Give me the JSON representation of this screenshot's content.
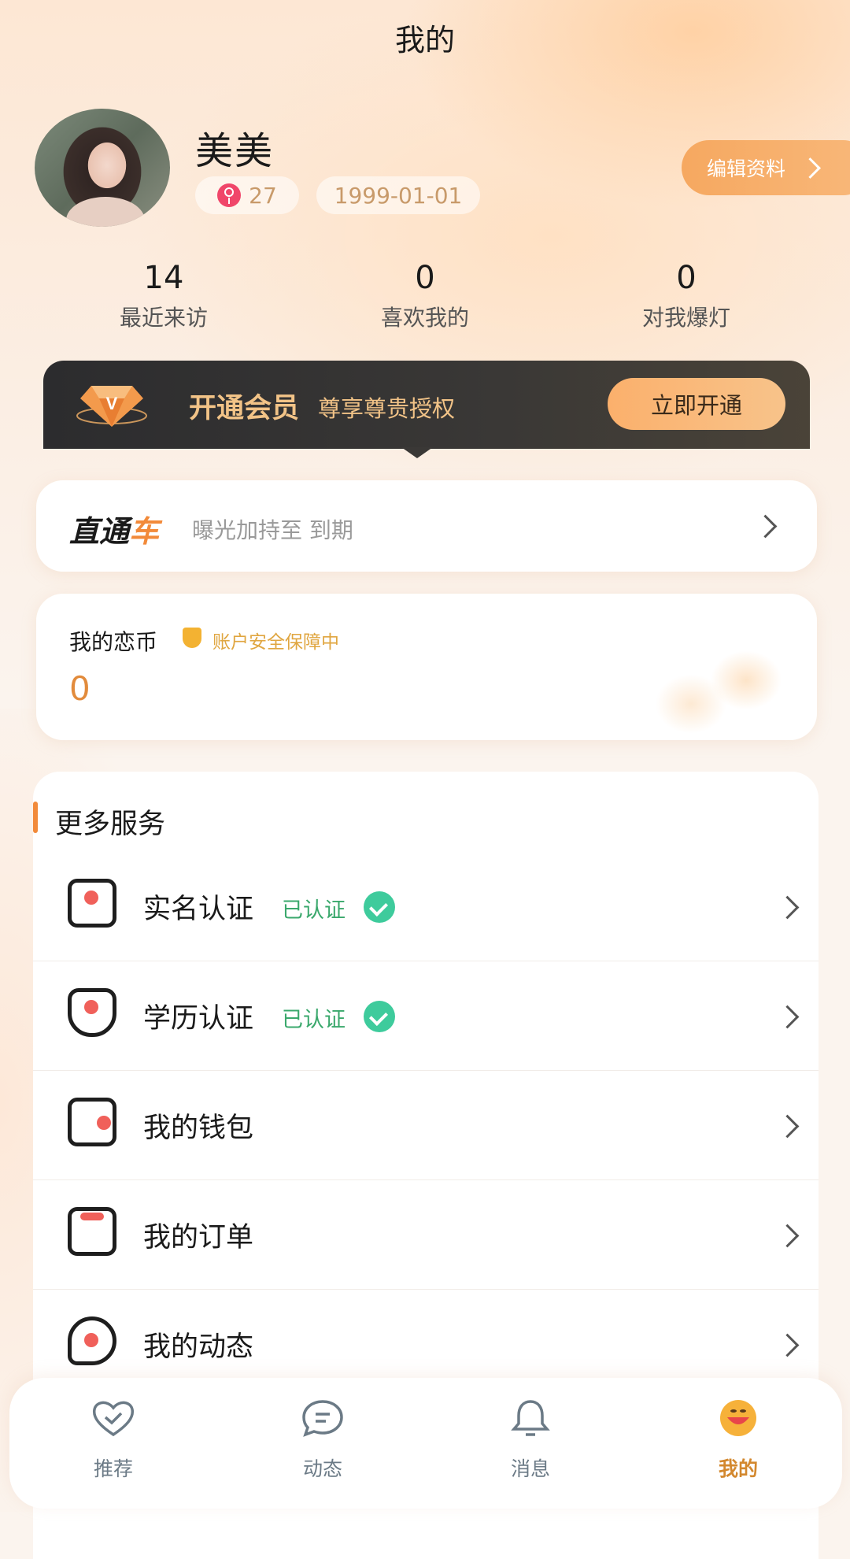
{
  "header": {
    "title": "我的"
  },
  "profile": {
    "name": "美美",
    "age": "27",
    "birthday": "1999-01-01",
    "edit_label": "编辑资料"
  },
  "stats": [
    {
      "value": "14",
      "label": "最近来访"
    },
    {
      "value": "0",
      "label": "喜欢我的"
    },
    {
      "value": "0",
      "label": "对我爆灯"
    }
  ],
  "vip": {
    "title": "开通会员",
    "subtitle": "尊享尊贵授权",
    "button": "立即开通"
  },
  "express": {
    "logo_a": "直通",
    "logo_b": "车",
    "text": "曝光加持至 到期"
  },
  "coins": {
    "title": "我的恋币",
    "secure": "账户安全保障中",
    "value": "0"
  },
  "services": {
    "title": "更多服务",
    "items": [
      {
        "label": "实名认证",
        "status": "已认证",
        "icon": "id-card-icon"
      },
      {
        "label": "学历认证",
        "status": "已认证",
        "icon": "shield-user-icon"
      },
      {
        "label": "我的钱包",
        "status": "",
        "icon": "wallet-icon"
      },
      {
        "label": "我的订单",
        "status": "",
        "icon": "order-icon"
      },
      {
        "label": "我的动态",
        "status": "",
        "icon": "hashtag-chat-icon"
      }
    ]
  },
  "tabs": [
    {
      "label": "推荐",
      "icon": "heart-check-icon",
      "active": false
    },
    {
      "label": "动态",
      "icon": "chat-bubble-icon",
      "active": false
    },
    {
      "label": "消息",
      "icon": "bell-icon",
      "active": false
    },
    {
      "label": "我的",
      "icon": "smiley-face-icon",
      "active": true
    }
  ],
  "colors": {
    "accent": "#f28a3a",
    "verified": "#3ecb9c",
    "gold": "#f2c387"
  }
}
